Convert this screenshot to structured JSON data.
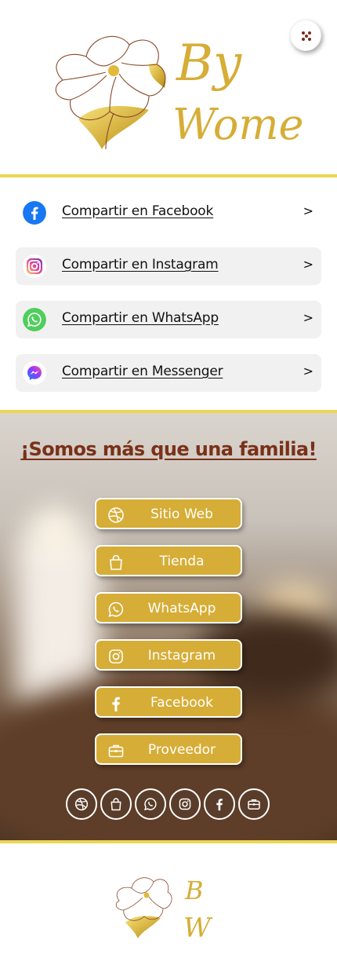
{
  "header": {
    "logo_text_line1": "By",
    "logo_text_line2": "Women",
    "menu_icon": "dots-icon"
  },
  "share": {
    "items": [
      {
        "label": "Compartir en Facebook",
        "arrow": ">",
        "icon": "facebook-icon"
      },
      {
        "label": "Compartir en Instagram",
        "arrow": ">",
        "icon": "instagram-icon"
      },
      {
        "label": "Compartir en WhatsApp",
        "arrow": ">",
        "icon": "whatsapp-icon"
      },
      {
        "label": "Compartir en Messenger",
        "arrow": ">",
        "icon": "messenger-icon"
      }
    ]
  },
  "hero": {
    "title": "¡Somos más que una familia!",
    "buttons": [
      {
        "label": "Sitio Web",
        "icon": "dribbble-icon"
      },
      {
        "label": "Tienda",
        "icon": "shopping-bag-icon"
      },
      {
        "label": "WhatsApp",
        "icon": "whatsapp-icon"
      },
      {
        "label": "Instagram",
        "icon": "instagram-icon"
      },
      {
        "label": "Facebook",
        "icon": "facebook-icon"
      },
      {
        "label": "Proveedor",
        "icon": "briefcase-icon"
      }
    ]
  },
  "footer": {
    "logo_text_line1": "B",
    "logo_text_line2": "W"
  },
  "colors": {
    "gold": "#d6ad36",
    "gold_rule": "#ecd553",
    "title_brown": "#7a3119",
    "facebook_blue": "#1877f2",
    "whatsapp_green": "#4fce5d"
  }
}
